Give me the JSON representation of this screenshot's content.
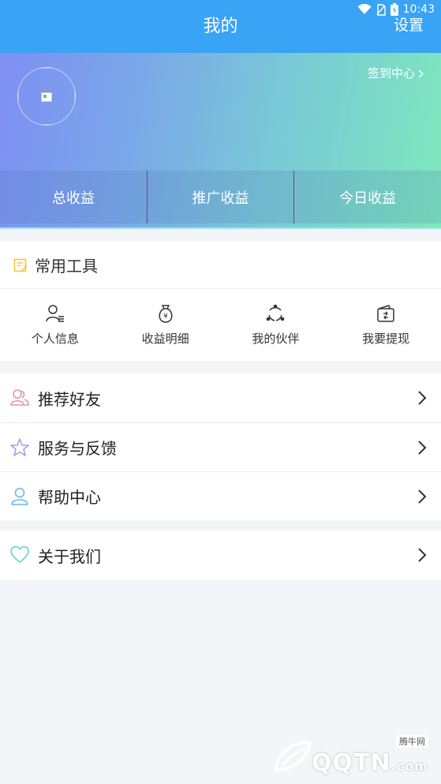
{
  "status": {
    "time": "10:43"
  },
  "header": {
    "title": "我的",
    "settings_label": "设置"
  },
  "banner": {
    "checkin_label": "签到中心",
    "earnings": [
      {
        "label": "总收益"
      },
      {
        "label": "推广收益"
      },
      {
        "label": "今日收益"
      }
    ]
  },
  "tools": {
    "title": "常用工具",
    "items": [
      {
        "label": "个人信息",
        "icon": "user-info-icon"
      },
      {
        "label": "收益明细",
        "icon": "money-bag-icon"
      },
      {
        "label": "我的伙伴",
        "icon": "share-nodes-icon"
      },
      {
        "label": "我要提现",
        "icon": "wallet-icon"
      }
    ]
  },
  "menu": {
    "group1": [
      {
        "label": "推荐好友",
        "icon": "friends-icon",
        "color": "#e98fb3"
      },
      {
        "label": "服务与反馈",
        "icon": "star-icon",
        "color": "#a89be8"
      },
      {
        "label": "帮助中心",
        "icon": "person-icon",
        "color": "#6fb6ec"
      }
    ],
    "group2": [
      {
        "label": "关于我们",
        "icon": "heart-icon",
        "color": "#5fd6c0"
      }
    ]
  },
  "watermark": {
    "brand": "QQTN",
    "suffix": ".com",
    "cn": "腾牛网"
  },
  "colors": {
    "primary": "#39a3f5",
    "divider": "#8b3a6e"
  }
}
